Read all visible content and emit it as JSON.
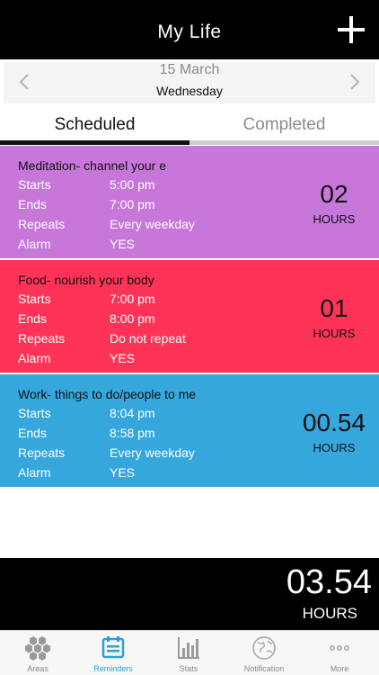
{
  "header": {
    "title": "My Life"
  },
  "date": {
    "day_month": "15 March",
    "weekday": "Wednesday"
  },
  "tabs": {
    "scheduled": "Scheduled",
    "completed": "Completed"
  },
  "labels": {
    "starts": "Starts",
    "ends": "Ends",
    "repeats": "Repeats",
    "alarm": "Alarm"
  },
  "reminders": [
    {
      "name": "Meditation- channel your e",
      "starts": "5:00 pm",
      "ends": "7:00 pm",
      "repeats": "Every weekday",
      "alarm": "YES",
      "duration": "02",
      "unit": "HOURS",
      "color": "#c777d9"
    },
    {
      "name": "Food- nourish your body",
      "starts": "7:00 pm",
      "ends": "8:00 pm",
      "repeats": "Do not repeat",
      "alarm": "YES",
      "duration": "01",
      "unit": "HOURS",
      "color": "#ff3358"
    },
    {
      "name": "Work- things to do/people to me",
      "starts": "8:04 pm",
      "ends": "8:58 pm",
      "repeats": "Every weekday",
      "alarm": "YES",
      "duration": "00.54",
      "unit": "HOURS",
      "color": "#35a7dc"
    }
  ],
  "total": {
    "value": "03.54",
    "unit": "HOURS"
  },
  "tabbar": [
    {
      "label": "Areas",
      "icon": "hexagons-icon"
    },
    {
      "label": "Reminders",
      "icon": "calendar-list-icon"
    },
    {
      "label": "Stats",
      "icon": "bar-chart-icon"
    },
    {
      "label": "Notification",
      "icon": "globe-icon"
    },
    {
      "label": "More",
      "icon": "more-dots-icon"
    }
  ],
  "colors": {
    "accent": "#2a9fd8",
    "header_bg": "#000000"
  }
}
